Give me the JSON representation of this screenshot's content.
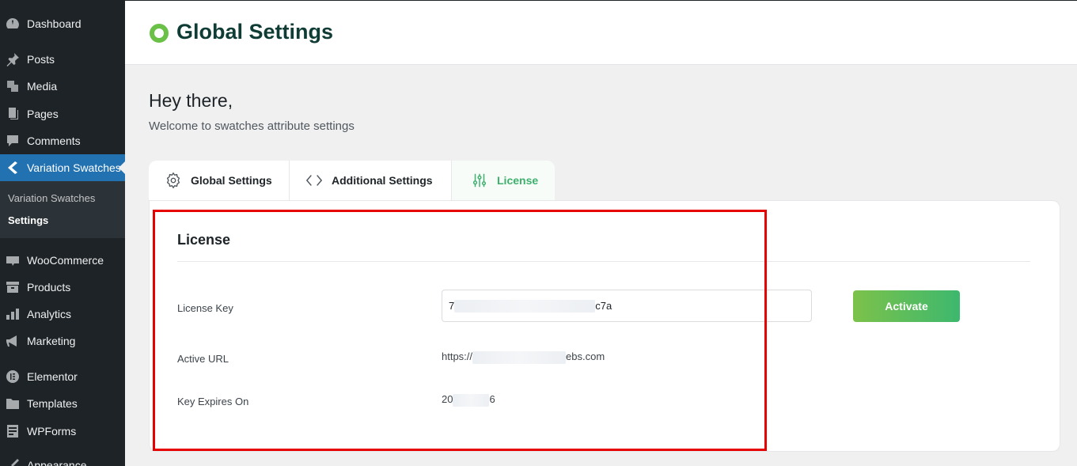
{
  "sidebar": {
    "items": [
      {
        "label": "Dashboard",
        "icon": "dashboard-icon"
      },
      {
        "label": "Posts",
        "icon": "pin-icon"
      },
      {
        "label": "Media",
        "icon": "media-icon"
      },
      {
        "label": "Pages",
        "icon": "pages-icon"
      },
      {
        "label": "Comments",
        "icon": "comment-icon"
      },
      {
        "label": "Variation Swatches",
        "icon": "chevron-left-icon"
      },
      {
        "label": "WooCommerce",
        "icon": "woo-icon"
      },
      {
        "label": "Products",
        "icon": "archive-icon"
      },
      {
        "label": "Analytics",
        "icon": "bar-chart-icon"
      },
      {
        "label": "Marketing",
        "icon": "megaphone-icon"
      },
      {
        "label": "Elementor",
        "icon": "elementor-icon"
      },
      {
        "label": "Templates",
        "icon": "folder-icon"
      },
      {
        "label": "WPForms",
        "icon": "form-icon"
      },
      {
        "label": "Appearance",
        "icon": "brush-icon"
      }
    ],
    "submenu": [
      {
        "label": "Variation Swatches"
      },
      {
        "label": "Settings"
      }
    ]
  },
  "header": {
    "title": "Global Settings"
  },
  "intro": {
    "greeting": "Hey there,",
    "subtitle": "Welcome to swatches attribute settings"
  },
  "tabs": [
    {
      "label": "Global Settings",
      "icon": "gear-icon"
    },
    {
      "label": "Additional Settings",
      "icon": "code-icon"
    },
    {
      "label": "License",
      "icon": "sliders-icon",
      "active": true
    }
  ],
  "license": {
    "title": "License",
    "key_label": "License Key",
    "key_prefix": "7",
    "key_suffix": "c7a",
    "url_label": "Active URL",
    "url_prefix": "https://",
    "url_suffix": "ebs.com",
    "expires_label": "Key Expires On",
    "expires_prefix": "20",
    "expires_suffix": "6",
    "activate_label": "Activate"
  },
  "colors": {
    "sidebar_bg": "#1d2327",
    "sidebar_active": "#2271b1",
    "accent_green": "#3db16c",
    "highlight_red": "#e60000"
  }
}
